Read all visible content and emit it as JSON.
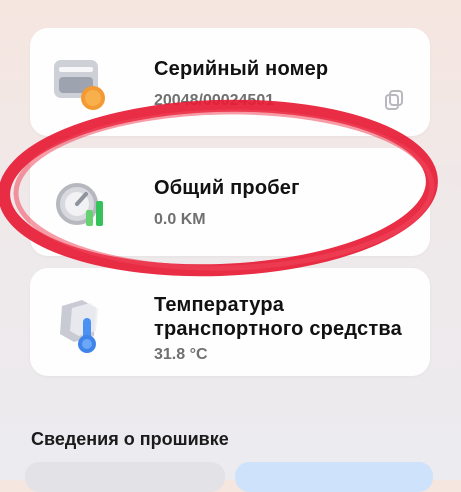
{
  "cards": [
    {
      "title": "Серийный номер",
      "value": "20048/00024501",
      "icon": "serial-number-icon",
      "action_icon": "copy-icon"
    },
    {
      "title": "Общий пробег",
      "value": "0.0 KM",
      "icon": "odometer-icon"
    },
    {
      "title": "Температура\nтранспортного средства",
      "value": "31.8 °C",
      "icon": "thermometer-icon"
    }
  ],
  "section": {
    "title": "Сведения о прошивке"
  },
  "colors": {
    "annotation_circle": "#e61b35",
    "card_background": "#ffffff",
    "page_background": "#efe9ea",
    "secondary_text": "#707070",
    "tile_left": "#e2e2e7",
    "tile_right": "#cfe2fb"
  }
}
